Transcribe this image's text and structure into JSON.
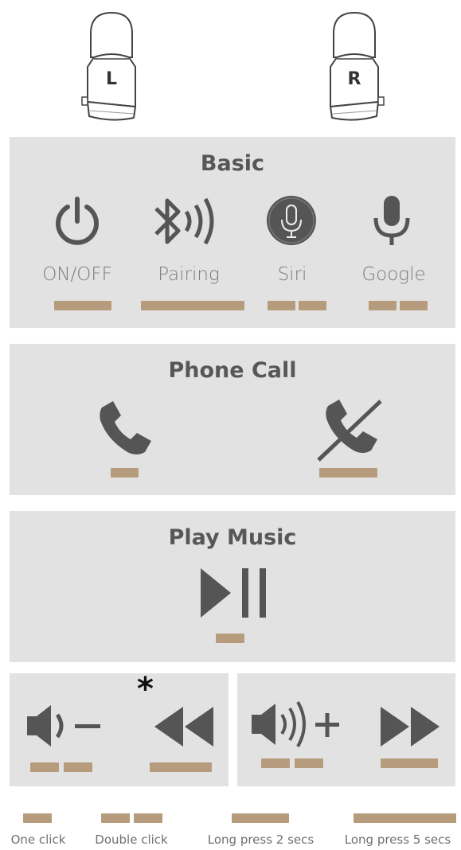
{
  "earbuds": {
    "left_label": "L",
    "right_label": "R"
  },
  "basic": {
    "title": "Basic",
    "items": [
      {
        "label": "ON/OFF",
        "icon": "power-icon",
        "gesture": "long-press-2"
      },
      {
        "label": "Pairing",
        "icon": "bluetooth-icon",
        "gesture": "long-press-5"
      },
      {
        "label": "Siri",
        "icon": "siri-microphone-icon",
        "gesture": "double-click"
      },
      {
        "label": "Google",
        "icon": "microphone-icon",
        "gesture": "double-click"
      }
    ]
  },
  "phone_call": {
    "title": "Phone Call",
    "items": [
      {
        "icon": "phone-answer-icon",
        "gesture": "one-click"
      },
      {
        "icon": "phone-reject-icon",
        "gesture": "long-press-2"
      }
    ]
  },
  "play_music": {
    "title": "Play Music",
    "items": [
      {
        "icon": "play-pause-icon",
        "gesture": "one-click"
      }
    ]
  },
  "controls": {
    "asterisk": "*",
    "left_panel": [
      {
        "icon": "volume-down-icon",
        "gesture": "double-click"
      },
      {
        "icon": "rewind-icon",
        "gesture": "long-press-2"
      }
    ],
    "right_panel": [
      {
        "icon": "volume-up-icon",
        "gesture": "double-click"
      },
      {
        "icon": "fast-forward-icon",
        "gesture": "long-press-2"
      }
    ]
  },
  "legend": [
    {
      "label": "One click",
      "gesture": "one-click"
    },
    {
      "label": "Double click",
      "gesture": "double-click"
    },
    {
      "label": "Long press 2 secs",
      "gesture": "long-press-2"
    },
    {
      "label": "Long press 5 secs",
      "gesture": "long-press-5"
    }
  ],
  "colors": {
    "panel": "#e2e2e2",
    "bar": "#b69c7c",
    "icon": "#555555",
    "label": "#7c7c7c"
  }
}
